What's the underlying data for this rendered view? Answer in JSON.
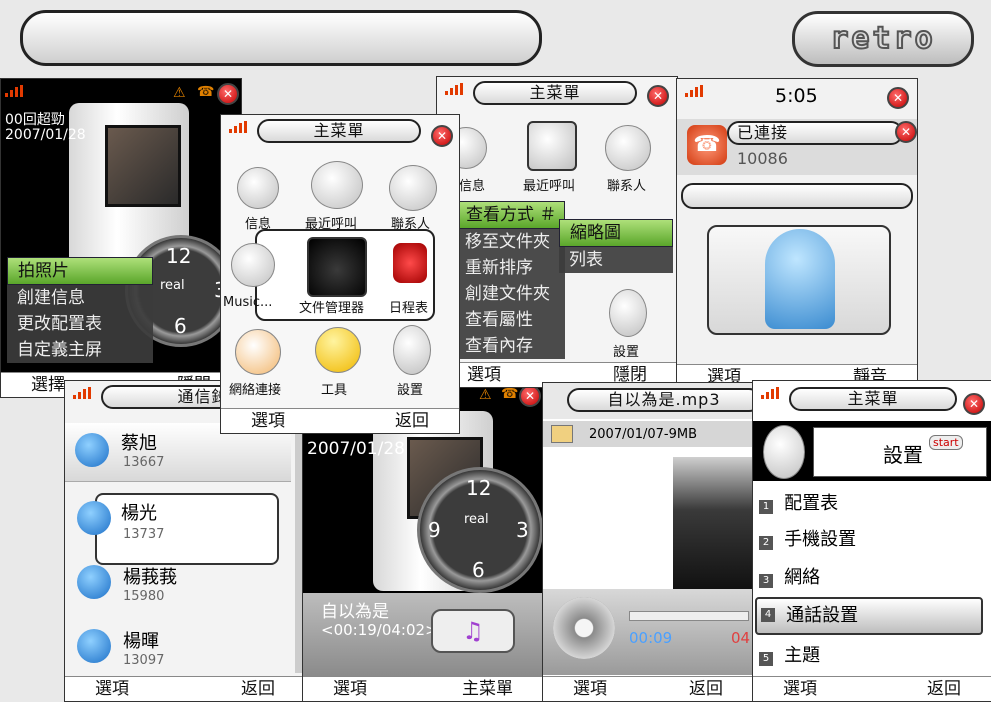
{
  "top": {
    "brand": "retro"
  },
  "colors": {
    "accent_green": "#7cc43c",
    "signal": "#e23a00",
    "close": "#d40000"
  },
  "win1": {
    "title": "",
    "event": "00回超勁",
    "date": "2007/01/28",
    "clock_numbers": [
      "12",
      "3",
      "6"
    ],
    "clock_label": "real",
    "menu": [
      "拍照片",
      "創建信息",
      "更改配置表",
      "自定義主屏"
    ],
    "soft_left": "選擇",
    "soft_right": "隱閉"
  },
  "win2": {
    "title": "主菜單",
    "icons": [
      {
        "name": "messages-icon",
        "label": "信息"
      },
      {
        "name": "recent-calls-icon",
        "label": "最近呼叫"
      },
      {
        "name": "contacts-icon",
        "label": "聯系人"
      },
      {
        "name": "music-icon",
        "label": "Music..."
      },
      {
        "name": "file-manager-icon",
        "label": "文件管理器"
      },
      {
        "name": "organizer-icon",
        "label": "日程表"
      },
      {
        "name": "network-icon",
        "label": "網絡連接"
      },
      {
        "name": "tools-icon",
        "label": "工具"
      },
      {
        "name": "settings-icon",
        "label": "設置"
      }
    ],
    "soft_left": "選項",
    "soft_right": "返回"
  },
  "win3": {
    "title": "主菜單",
    "icons": [
      {
        "name": "messages-icon",
        "label": "信息"
      },
      {
        "name": "recent-calls-icon",
        "label": "最近呼叫"
      },
      {
        "name": "contacts-icon",
        "label": "聯系人"
      },
      {
        "name": "settings-icon",
        "label": "設置"
      }
    ],
    "menu": [
      "查看方式 ＃",
      "移至文件夾",
      "重新排序",
      "創建文件夾",
      "查看屬性",
      "查看內存"
    ],
    "submenu": [
      "縮略圖",
      "列表"
    ],
    "soft_left": "選項",
    "soft_right": "隱閉"
  },
  "win4": {
    "time": "5:05",
    "caller": "已連接",
    "number": "10086",
    "soft_left": "選項",
    "soft_right": "靜音"
  },
  "win5": {
    "title": "通信錄",
    "contacts": [
      {
        "name": "蔡旭",
        "number": "13667"
      },
      {
        "name": "楊光",
        "number": "13737"
      },
      {
        "name": "楊莪莪",
        "number": "15980"
      },
      {
        "name": "楊暉",
        "number": "13097"
      }
    ],
    "soft_left": "選項",
    "soft_right": "返回"
  },
  "win6": {
    "date": "2007/01/28",
    "clock_numbers": [
      "12",
      "3",
      "6",
      "9"
    ],
    "clock_label": "real",
    "track": "自以為是",
    "progress": "<00:19/04:02>",
    "soft_left": "選項",
    "soft_right": "主菜單"
  },
  "win7": {
    "title": "自以為是.mp3",
    "info": "2007/01/07-9MB",
    "time_elapsed": "00:09",
    "time_total": "04",
    "soft_left": "選項",
    "soft_right": "返回"
  },
  "win8": {
    "title": "主菜單",
    "header": "設置",
    "start": "start",
    "items": [
      {
        "num": "1",
        "label": "配置表"
      },
      {
        "num": "2",
        "label": "手機設置"
      },
      {
        "num": "3",
        "label": "網絡"
      },
      {
        "num": "4",
        "label": "通話設置"
      },
      {
        "num": "5",
        "label": "主題"
      }
    ],
    "soft_left": "選項",
    "soft_right": "返回"
  }
}
